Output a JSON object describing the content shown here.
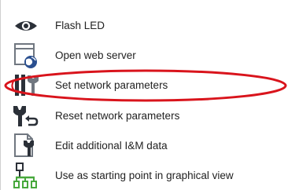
{
  "colors": {
    "icon_dark": "#2b3038",
    "icon_gray": "#707780",
    "globe_blue": "#2a4f8f",
    "connector_green": "#47a83c",
    "highlight_red": "#d9141c"
  },
  "menu": {
    "items": [
      {
        "label": "Flash LED",
        "icon": "eye-icon"
      },
      {
        "label": "Open web server",
        "icon": "web-server-globe-icon"
      },
      {
        "label": "Set network parameters",
        "icon": "network-parameters-wrench-icon"
      },
      {
        "label": "Reset network parameters",
        "icon": "reset-wrench-icon"
      },
      {
        "label": "Edit additional I&M data",
        "icon": "edit-document-wrench-icon"
      },
      {
        "label": "Use as starting point in graphical view",
        "icon": "topology-tree-icon"
      }
    ]
  },
  "annotation": {
    "highlighted_item": "Set network parameters"
  }
}
